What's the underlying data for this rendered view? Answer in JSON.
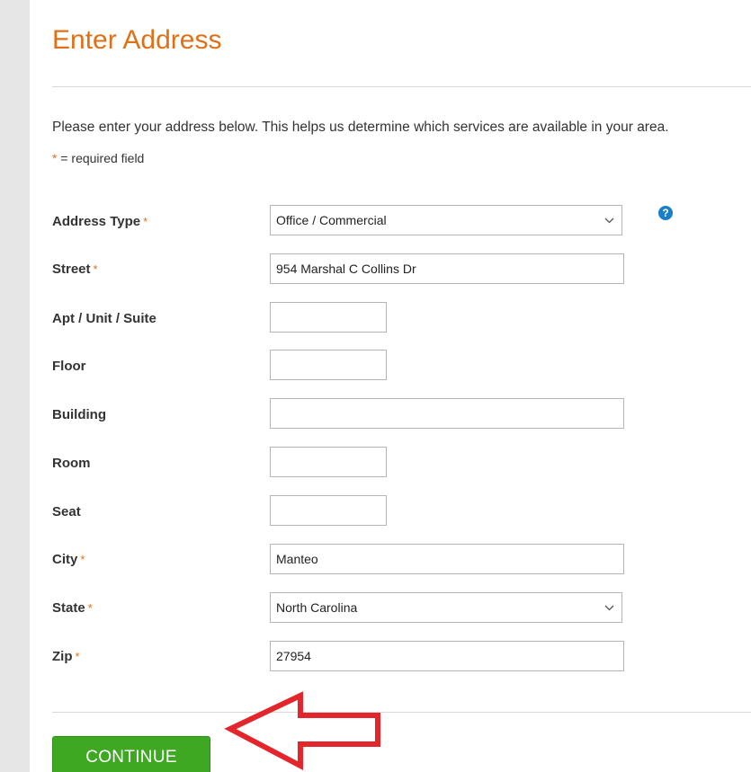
{
  "header": {
    "cut_text": "                                                                                                      ",
    "title": "Enter Address"
  },
  "intro": "Please enter your address below. This helps us determine which services are available in your area.",
  "required_note": {
    "marker": "*",
    "text": " = required field"
  },
  "form": {
    "address_type": {
      "label": "Address Type",
      "required": "*",
      "value": "Office / Commercial"
    },
    "street": {
      "label": "Street",
      "required": "*",
      "value": "954 Marshal C Collins Dr"
    },
    "apt": {
      "label": "Apt / Unit / Suite",
      "value": ""
    },
    "floor": {
      "label": "Floor",
      "value": ""
    },
    "building": {
      "label": "Building",
      "value": ""
    },
    "room": {
      "label": "Room",
      "value": ""
    },
    "seat": {
      "label": "Seat",
      "value": ""
    },
    "city": {
      "label": "City",
      "required": "*",
      "value": "Manteo"
    },
    "state": {
      "label": "State",
      "required": "*",
      "value": "North Carolina"
    },
    "zip": {
      "label": "Zip",
      "required": "*",
      "value": "27954"
    }
  },
  "help_icon": {
    "glyph": "?"
  },
  "continue_label": "CONTINUE",
  "colors": {
    "title": "#e07016",
    "required": "#e07016",
    "button": "#3ea823",
    "help": "#1a7fc9",
    "arrow": "#e3262b"
  }
}
